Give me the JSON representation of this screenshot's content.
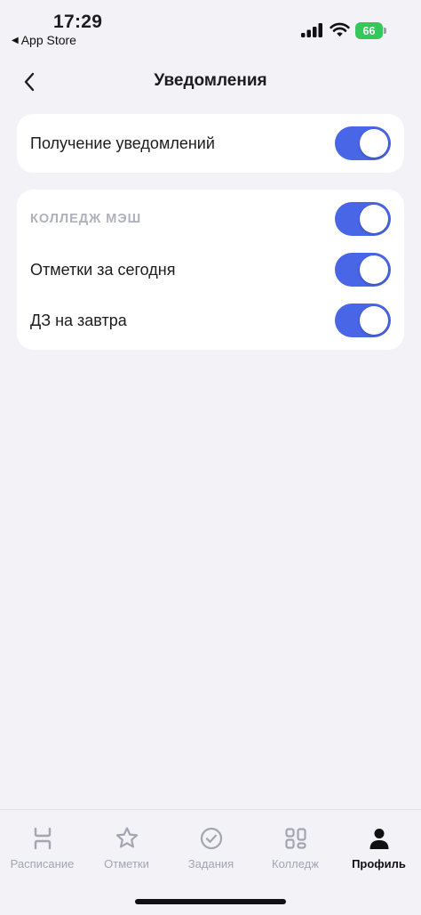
{
  "status_bar": {
    "time": "17:29",
    "back_app": "App Store",
    "back_arrow": "◀",
    "battery": "66",
    "battery_color": "#35c759",
    "icons": [
      "signal-icon",
      "wifi-icon",
      "battery-icon"
    ]
  },
  "header": {
    "title": "Уведомления",
    "back_icon": "chevron-left-icon"
  },
  "sections": [
    {
      "rows": [
        {
          "label": "Получение уведомлений",
          "enabled": true
        }
      ]
    },
    {
      "header": {
        "label": "КОЛЛЕДЖ МЭШ",
        "enabled": true
      },
      "rows": [
        {
          "label": "Отметки за сегодня",
          "enabled": true
        },
        {
          "label": "ДЗ на завтра",
          "enabled": true
        }
      ]
    }
  ],
  "tabs": [
    {
      "label": "Расписание",
      "icon": "schedule-icon",
      "active": false
    },
    {
      "label": "Отметки",
      "icon": "star-icon",
      "active": false
    },
    {
      "label": "Задания",
      "icon": "check-circle-icon",
      "active": false
    },
    {
      "label": "Колледж",
      "icon": "grid-icon",
      "active": false
    },
    {
      "label": "Профиль",
      "icon": "person-icon",
      "active": true
    }
  ],
  "colors": {
    "toggle_on": "#4966e7",
    "background": "#f2f2f7",
    "tab_inactive": "#a3a5b1",
    "tab_active": "#111111"
  }
}
